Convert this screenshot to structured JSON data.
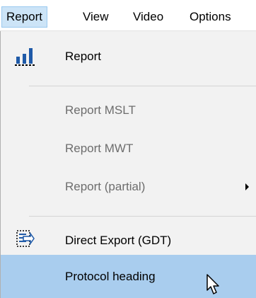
{
  "menubar": {
    "items": [
      {
        "label": "Report"
      },
      {
        "label": "View"
      },
      {
        "label": "Video"
      },
      {
        "label": "Options"
      }
    ]
  },
  "dropdown": {
    "items": [
      {
        "label": "Report",
        "enabled": true,
        "icon": "bar-chart-icon"
      },
      {
        "label": "Report MSLT",
        "enabled": false
      },
      {
        "label": "Report MWT",
        "enabled": false
      },
      {
        "label": "Report (partial)",
        "enabled": false,
        "submenu": true
      },
      {
        "label": "Direct Export (GDT)",
        "enabled": true,
        "icon": "export-icon"
      },
      {
        "label": "Protocol heading",
        "enabled": true,
        "highlighted": true
      }
    ]
  },
  "colors": {
    "highlight": "#a9cdee",
    "active_menubar": "#cce4f7",
    "icon_blue": "#1f5aa8"
  }
}
